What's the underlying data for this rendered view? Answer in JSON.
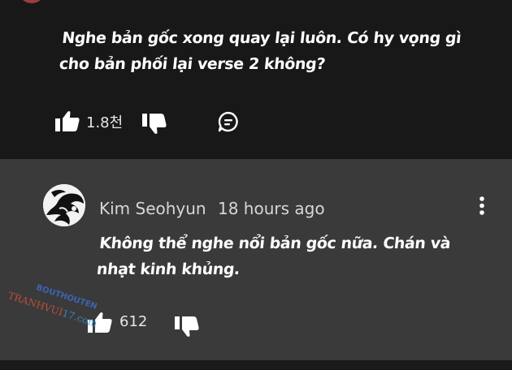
{
  "top_comment": {
    "text_line1": "Nghe bản gốc xong quay lại luôn. Có hy vọng gì",
    "text_line2": "cho bản phối lại verse 2 không?",
    "like_count": "1.8천"
  },
  "reply": {
    "author": "Kim Seohyun",
    "time": "18 hours ago",
    "text_line1": "Không thể nghe nổi bản gốc nữa. Chán và",
    "text_line2": "nhạt kinh khủng.",
    "like_count": "612"
  },
  "watermark": {
    "line1": "BOUTHOUTEN",
    "line2_a": "TRANHVUI",
    "line2_b": "17",
    "line2_c": ".com"
  },
  "icons": {
    "like": "thumbs-up-icon",
    "dislike": "thumbs-down-icon",
    "reply": "comment-bubble-icon",
    "more": "more-vertical-icon"
  },
  "colors": {
    "top_background": "#181818",
    "reply_background": "#3a3a3a",
    "text": "#ffffff",
    "meta_text": "#d7d7d7"
  }
}
